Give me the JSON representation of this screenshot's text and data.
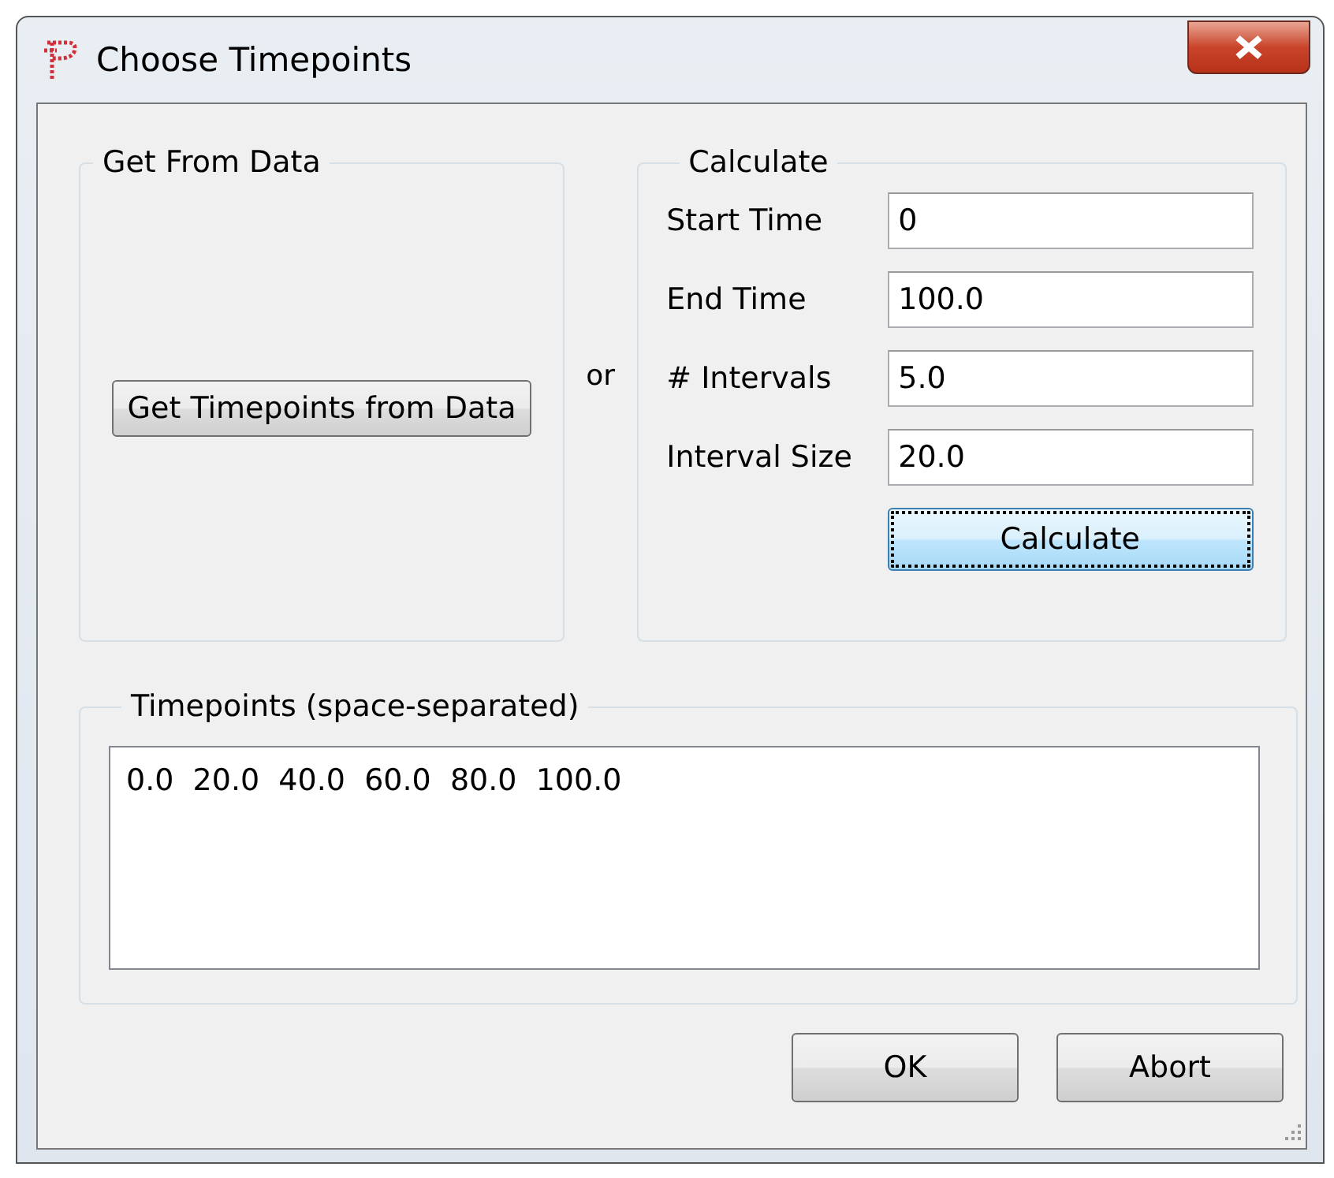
{
  "window": {
    "title": "Choose Timepoints"
  },
  "get_from_data": {
    "title": "Get From Data",
    "button": "Get Timepoints from Data"
  },
  "separator_text": "or",
  "calculate": {
    "title": "Calculate",
    "fields": [
      {
        "label": "Start Time",
        "value": "0"
      },
      {
        "label": "End Time",
        "value": "100.0"
      },
      {
        "label": "# Intervals",
        "value": "5.0"
      },
      {
        "label": "Interval Size",
        "value": "20.0"
      }
    ],
    "button": {
      "label": "Calculate",
      "focused": true
    }
  },
  "timepoints": {
    "title": "Timepoints (space-separated)",
    "value": "0.0  20.0  40.0  60.0  80.0  100.0"
  },
  "buttons": [
    "OK",
    "Abort"
  ]
}
